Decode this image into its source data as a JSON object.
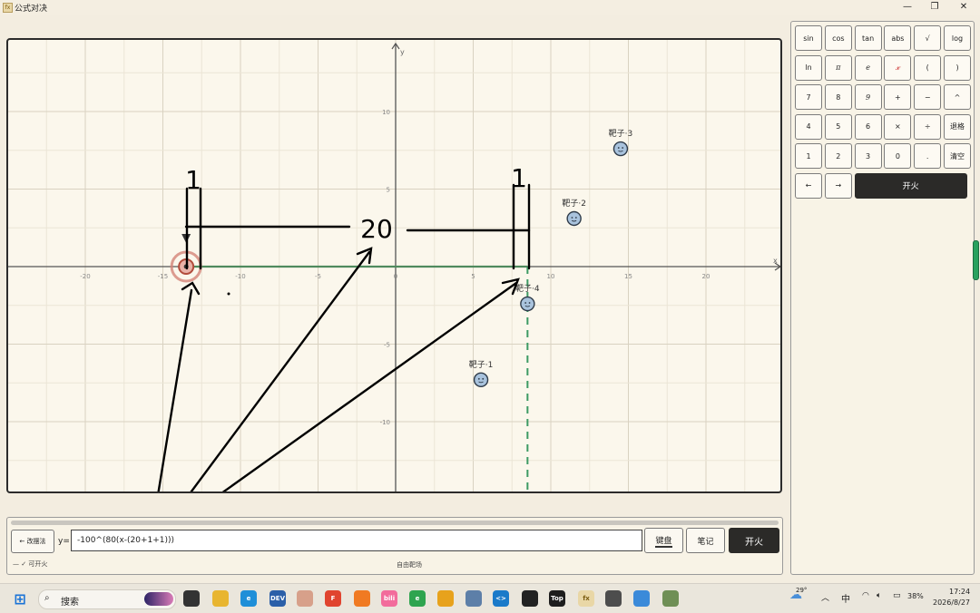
{
  "window": {
    "title": "公式对决",
    "app_icon_text": "fx",
    "minimize_icon": "minimize-icon",
    "maximize_icon": "restore-icon",
    "close_icon": "close-icon"
  },
  "chart_data": {
    "type": "scatter",
    "title": "",
    "xlabel": "x",
    "ylabel": "y",
    "xlim": [
      -25,
      25
    ],
    "ylim": [
      -14.5,
      14.5
    ],
    "grid": true,
    "xticks": [
      -20,
      -15,
      -10,
      -5,
      0,
      5,
      10,
      15,
      20
    ],
    "yticks": [
      -10,
      -5,
      5,
      10
    ],
    "player": {
      "x": -13.5,
      "y": 0
    },
    "targets": [
      {
        "label": "靶子·1",
        "x": 5.5,
        "y": -7.3
      },
      {
        "label": "靶子·2",
        "x": 11.5,
        "y": 3.1
      },
      {
        "label": "靶子·3",
        "x": 14.5,
        "y": 7.6
      },
      {
        "label": "靶子·4",
        "x": 8.5,
        "y": -2.4
      }
    ],
    "curve": {
      "x_from": -13.5,
      "x_to": 8.5,
      "y": 0,
      "color": "#4f8a5e"
    },
    "dashed_line_x": 8.5,
    "annotations": {
      "left_one": "1",
      "gap": "20",
      "right_one": "1"
    }
  },
  "formula": {
    "prefix": "y=",
    "value": "-100^(80(x-(20+1+1)))"
  },
  "controls": {
    "back_label": "← 改摆法",
    "keyboard_label": "键盘",
    "notes_label": "笔记",
    "fire_label": "开火",
    "status_text": "— ✓ 可开火",
    "mode_text": "自由靶场"
  },
  "keypad": {
    "rows": [
      [
        "sin",
        "cos",
        "tan",
        "abs",
        "√",
        "log"
      ],
      [
        "ln",
        "π",
        "e",
        "𝓍",
        "(",
        ")"
      ],
      [
        "7",
        "8",
        "9",
        "+",
        "−",
        "^"
      ],
      [
        "4",
        "5",
        "6",
        "×",
        "÷",
        "退格"
      ],
      [
        "1",
        "2",
        "3",
        "0",
        ".",
        "清空"
      ]
    ],
    "left_arrow": "←",
    "right_arrow": "→",
    "fire_label": "开火"
  },
  "taskbar": {
    "search_placeholder": "搜索",
    "weather_temp": "29°",
    "ime": "中",
    "battery": "38%",
    "time": "17:24",
    "date": "2026/8/27",
    "apps": [
      {
        "icon": "file-explorer-icon",
        "color": "#e8b530",
        "text": ""
      },
      {
        "icon": "edge-icon",
        "color": "#1f8fd8",
        "text": "e"
      },
      {
        "icon": "devcpp-icon",
        "color": "#2b5fa8",
        "text": "DEV"
      },
      {
        "icon": "avatar-app-icon",
        "color": "#d7a08a",
        "text": ""
      },
      {
        "icon": "feishu-icon",
        "color": "#e0442f",
        "text": "F"
      },
      {
        "icon": "orange-app-icon",
        "color": "#f07a22",
        "text": ""
      },
      {
        "icon": "bilibili-icon",
        "color": "#f26c9c",
        "text": "bili"
      },
      {
        "icon": "green-app-icon",
        "color": "#2ea44f",
        "text": "e"
      },
      {
        "icon": "yellow-app-icon",
        "color": "#e7a21c",
        "text": ""
      },
      {
        "icon": "settings-app-icon",
        "color": "#5d7fa8",
        "text": ""
      },
      {
        "icon": "vscode-icon",
        "color": "#1a7ac9",
        "text": "<>"
      },
      {
        "icon": "qq-icon",
        "color": "#222222",
        "text": ""
      },
      {
        "icon": "top-app-icon",
        "color": "#1d1d1d",
        "text": "Top"
      },
      {
        "icon": "formula-app-icon",
        "color": "#e9d7a6",
        "text": "fx"
      },
      {
        "icon": "calculator-icon",
        "color": "#4d4d4d",
        "text": ""
      },
      {
        "icon": "globe-app-icon",
        "color": "#3b8ad9",
        "text": ""
      },
      {
        "icon": "tree-app-icon",
        "color": "#6f8f55",
        "text": ""
      }
    ]
  }
}
